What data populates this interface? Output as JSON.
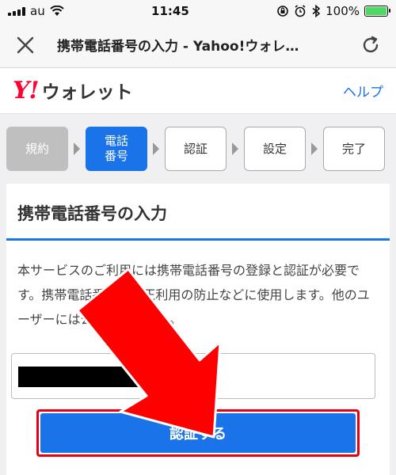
{
  "statusbar": {
    "carrier": "au",
    "time": "11:45",
    "battery": "100%",
    "battery_level": 1.0
  },
  "navbar": {
    "title": "携帯電話番号の入力 - Yahoo!ウォレ…"
  },
  "header": {
    "logo_mark": "Y!",
    "logo_text": "ウォレット",
    "help": "ヘルプ"
  },
  "steps": [
    {
      "label": "規約",
      "state": "done"
    },
    {
      "label": "電話\n番号",
      "state": "active"
    },
    {
      "label": "認証",
      "state": "pending"
    },
    {
      "label": "設定",
      "state": "pending"
    },
    {
      "label": "完了",
      "state": "pending"
    }
  ],
  "card": {
    "title": "携帯電話番号の入力",
    "description": "本サービスのご利用には携帯電話番号の登録と認証が必要です。携帯電話番号は不正利用の防止などに使用します。他のユーザーには公開されません。",
    "submit": "認証する"
  },
  "colors": {
    "accent": "#1a73e8",
    "brand": "#ff0033",
    "highlight": "#e60012"
  }
}
